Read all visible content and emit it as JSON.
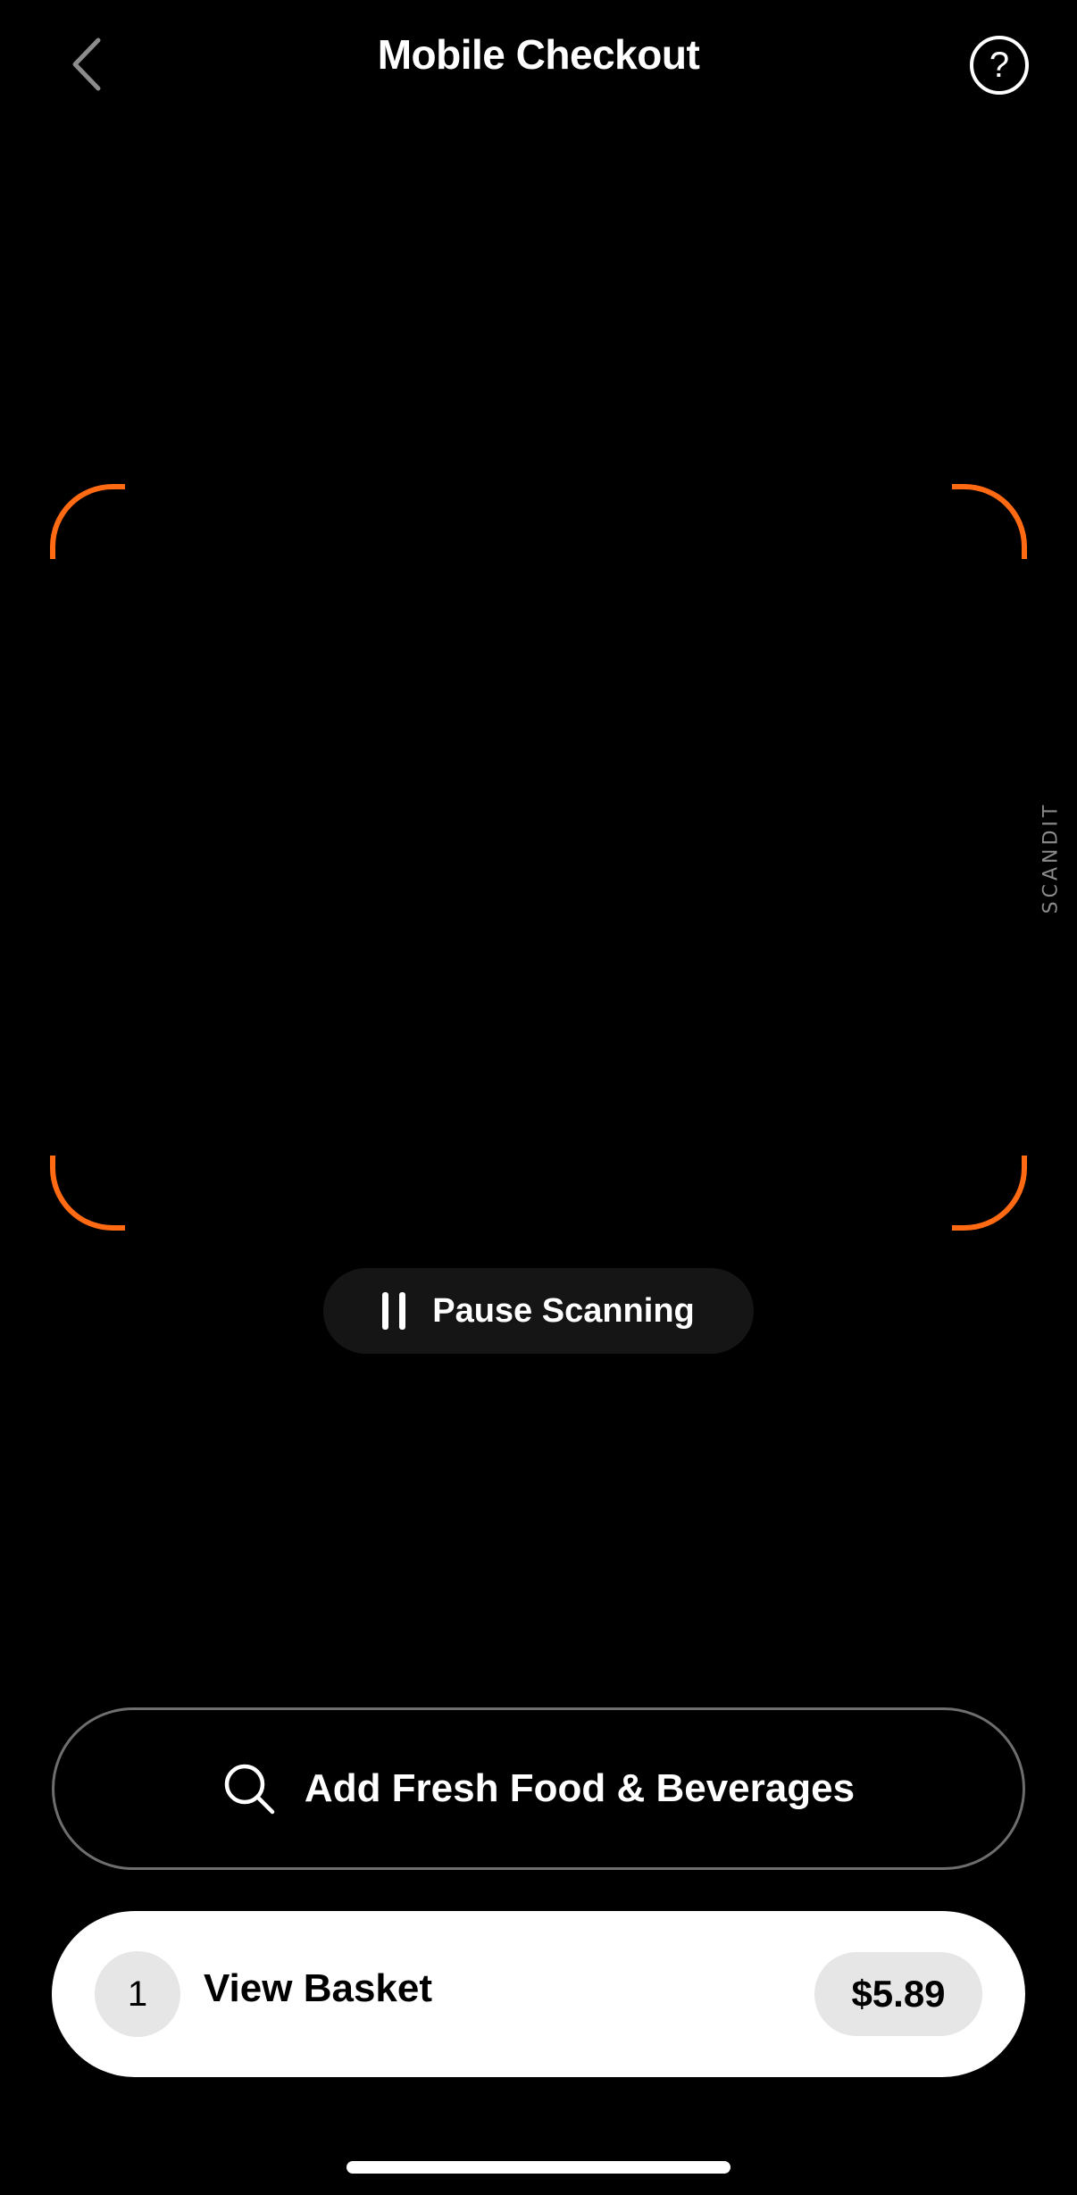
{
  "header": {
    "title": "Mobile Checkout",
    "back_icon": "chevron-left-icon",
    "help_label": "?"
  },
  "scanner": {
    "brand_logo": "SCANDIT",
    "accent_color": "#ff6a13",
    "pause_label": "Pause Scanning",
    "pause_icon": "pause-icon"
  },
  "actions": {
    "fresh_food_label": "Add Fresh Food & Beverages",
    "fresh_food_icon": "search-icon"
  },
  "basket": {
    "count": "1",
    "label": "View Basket",
    "total": "$5.89"
  }
}
